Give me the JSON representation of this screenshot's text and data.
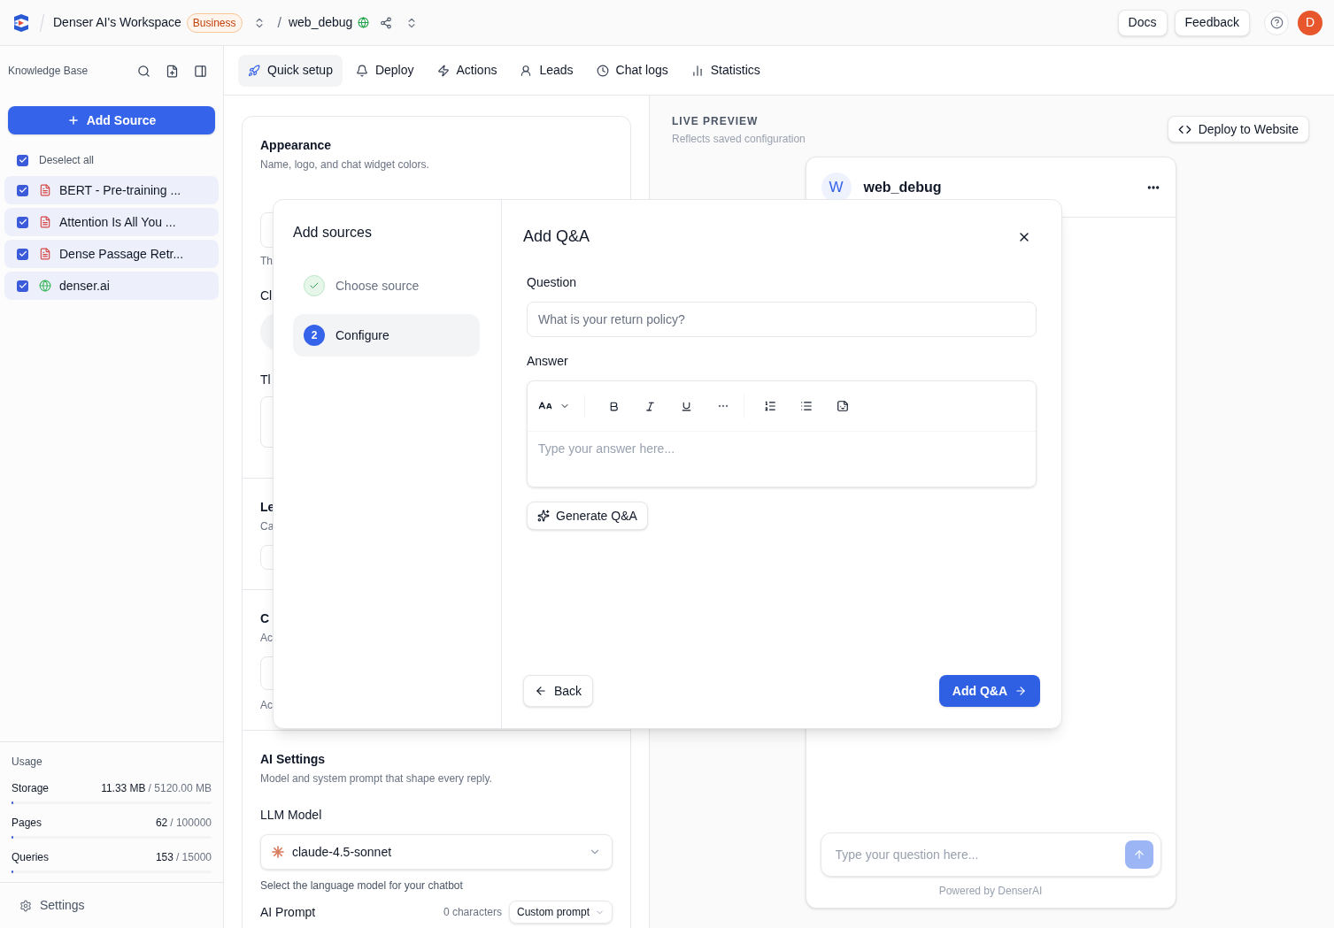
{
  "top_bar": {
    "workspace": "Denser AI's Workspace",
    "plan_badge": "Business",
    "separator": "/",
    "project": "web_debug",
    "project_live": true,
    "links": [
      "Docs",
      "Feedback"
    ],
    "avatar": "D"
  },
  "sidebar": {
    "title": "Knowledge Base",
    "add_button": "Add Source",
    "deselect_all": {
      "label": "Deselect all",
      "checked": true
    },
    "sources": [
      {
        "name": "BERT - Pre-training ...",
        "kind": "pdf",
        "checked": true
      },
      {
        "name": "Attention Is All You ...",
        "kind": "pdf",
        "checked": true
      },
      {
        "name": "Dense Passage Retr...",
        "kind": "pdf",
        "checked": true
      },
      {
        "name": "denser.ai",
        "kind": "web",
        "checked": true
      }
    ],
    "usage": {
      "title": "Usage",
      "meters": [
        {
          "name": "Storage",
          "used": "11.33 MB",
          "total": "/ 5120.00 MB",
          "level": 0.0022
        },
        {
          "name": "Pages",
          "used": "62",
          "total": "/ 100000",
          "level": 0.0006
        },
        {
          "name": "Queries",
          "used": "153",
          "total": "/ 15000",
          "level": 0.0102
        }
      ]
    },
    "settings": "Settings"
  },
  "tabs": [
    {
      "label": "Quick setup",
      "selected": true
    },
    {
      "label": "Deploy",
      "selected": false
    },
    {
      "label": "Actions",
      "selected": false
    },
    {
      "label": "Leads",
      "selected": false
    },
    {
      "label": "Chat logs",
      "selected": false
    },
    {
      "label": "Statistics",
      "selected": false
    }
  ],
  "settings_panel": {
    "appearance": {
      "title": "Appearance",
      "subtitle": "Name, logo, and chat widget colors.",
      "fragment_1": "Th",
      "fragment_2": "Cl",
      "fragment_3": "Tl"
    },
    "section_2": {
      "fragment_1": "Le",
      "fragment_2": "Ca"
    },
    "section_3": {
      "fragment_1": "C",
      "fragment_2": "Ac",
      "fragment_3": "Ac"
    },
    "ai_settings": {
      "title": "AI Settings",
      "subtitle": "Model and system prompt that shape every reply.",
      "model_label": "LLM Model",
      "model": "claude-4.5-sonnet",
      "model_hint": "Select the language model for your chatbot",
      "prompt_label": "AI Prompt",
      "prompt_count": "0 characters",
      "prompt_mode": "Custom prompt"
    }
  },
  "preview": {
    "title": "LIVE PREVIEW",
    "subtitle": "Reflects saved configuration",
    "deploy_button": "Deploy to Website",
    "widget": {
      "avatar": "W",
      "name": "web_debug",
      "input_placeholder": "Type your question here...",
      "footer": "Powered by DenserAI"
    }
  },
  "dialog": {
    "sidebar_title": "Add sources",
    "steps": [
      {
        "label": "Choose source",
        "kind": "done",
        "selected": false
      },
      {
        "label": "Configure",
        "kind": "current",
        "number": "2",
        "selected": true
      }
    ],
    "title": "Add Q&A",
    "question_label": "Question",
    "question_placeholder": "What is your return policy?",
    "answer_label": "Answer",
    "answer_placeholder": "Type your answer here...",
    "generate_button": "Generate Q&A",
    "back_button": "Back",
    "submit_button": "Add Q&A"
  }
}
